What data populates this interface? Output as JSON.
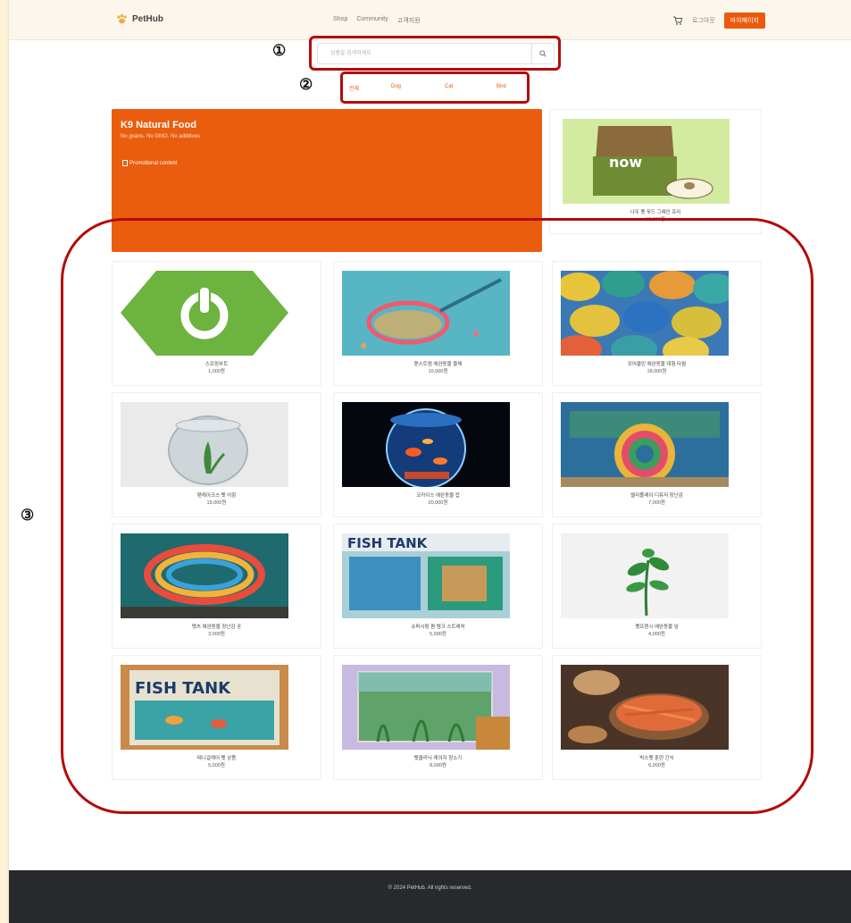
{
  "header": {
    "logo_text": "PetHub",
    "nav": [
      "Shop",
      "Community",
      "고객지원"
    ],
    "login_label": "로그아웃",
    "mypage_label": "마이페이지"
  },
  "search": {
    "placeholder": "상품을 검색하세요"
  },
  "filters": [
    "전체",
    "Dog",
    "Cat",
    "Bird"
  ],
  "annotations": [
    "①",
    "②",
    "③"
  ],
  "banner": {
    "title": "K9 Natural Food",
    "subtitle": "No grains. No GMO. No additives",
    "image_alt": "Promotional content"
  },
  "featured_product": {
    "name": "나우 펫 푸드 그레인 프리",
    "price": "18,000원"
  },
  "products": [
    {
      "name": "스프링부트",
      "price": "1,000원"
    },
    {
      "name": "랜스트럼 애완동물 뜰채",
      "price": "10,000원"
    },
    {
      "name": "모어클린 애완동물 대형 타월",
      "price": "18,000원"
    },
    {
      "name": "팬케이크스 펫 어항",
      "price": "15,000원"
    },
    {
      "name": "코카이스 애완동물 컵",
      "price": "20,000원"
    },
    {
      "name": "벨리플레이 디퓨저 장난감",
      "price": "7,000원"
    },
    {
      "name": "펫츠 애완동물 장난감 공",
      "price": "3,000원"
    },
    {
      "name": "슈퍼시핑 펌 탱크 스트레처",
      "price": "5,000원"
    },
    {
      "name": "펫프렌시 애완동물 잎",
      "price": "4,000원"
    },
    {
      "name": "테니걸케어 펫 상품",
      "price": "5,000원"
    },
    {
      "name": "펫클리닉 케이지 청소기",
      "price": "8,000원"
    },
    {
      "name": "빅스펫 훈련 간식",
      "price": "6,000원"
    }
  ],
  "footer": {
    "copyright": "© 2024 PetHub. All rights reserved."
  },
  "colors": {
    "accent": "#ea5a0c",
    "annotation": "#b30b0b",
    "footer_bg": "#27292d"
  }
}
